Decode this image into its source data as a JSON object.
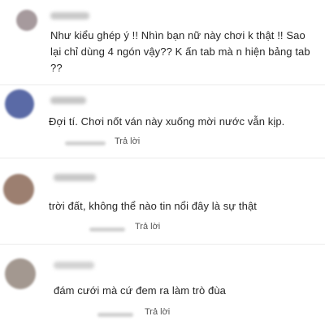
{
  "colors": {
    "background": "#ffffff",
    "text": "#262626",
    "reply": "#555555",
    "divider": "#ececec"
  },
  "comments": [
    {
      "avatar_color": "#a69a9d",
      "text_lines": [
        "Như kiểu ghép ý !! Nhìn bạn nữ này chơi k thật !! Sao",
        "lại chỉ dùng 4 ngón vậy?? K ấn tab mà n hiện bảng tab",
        "??"
      ],
      "reply_label": ""
    },
    {
      "avatar_color": "#5a6aa6",
      "text_lines": [
        "Đợi tí. Chơi nốt ván này xuống mời nước vẫn kịp."
      ],
      "reply_label": "Trả lời"
    },
    {
      "avatar_color": "#9c7f70",
      "text_lines": [
        "trời đất, không thể nào tin nổi đây là sự thật"
      ],
      "reply_label": "Trả lời"
    },
    {
      "avatar_color": "#a39890",
      "text_lines": [
        "đám cưới mà cứ đem ra làm trò đùa"
      ],
      "reply_label": "Trả lời"
    }
  ]
}
